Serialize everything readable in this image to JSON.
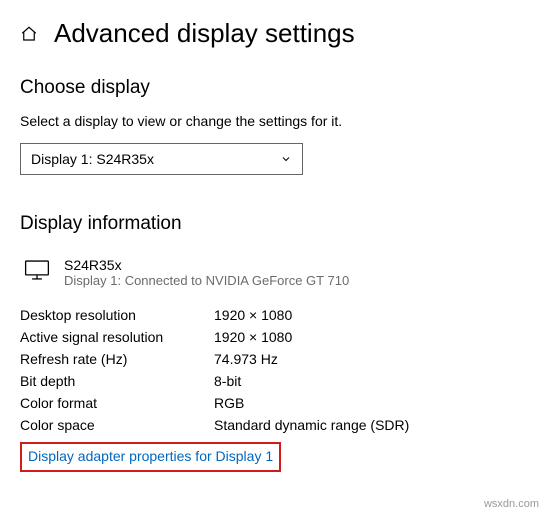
{
  "header": {
    "title": "Advanced display settings"
  },
  "choose": {
    "heading": "Choose display",
    "instruction": "Select a display to view or change the settings for it.",
    "selected": "Display 1: S24R35x"
  },
  "info": {
    "heading": "Display information",
    "monitor": {
      "name": "S24R35x",
      "sub": "Display 1: Connected to NVIDIA GeForce GT 710"
    },
    "rows": {
      "desktop_res": {
        "label": "Desktop resolution",
        "value": "1920 × 1080"
      },
      "active_res": {
        "label": "Active signal resolution",
        "value": "1920 × 1080"
      },
      "refresh": {
        "label": "Refresh rate (Hz)",
        "value": "74.973 Hz"
      },
      "bit_depth": {
        "label": "Bit depth",
        "value": "8-bit"
      },
      "color_fmt": {
        "label": "Color format",
        "value": "RGB"
      },
      "color_space": {
        "label": "Color space",
        "value": "Standard dynamic range (SDR)"
      }
    },
    "link": "Display adapter properties for Display 1"
  },
  "watermark": "wsxdn.com"
}
